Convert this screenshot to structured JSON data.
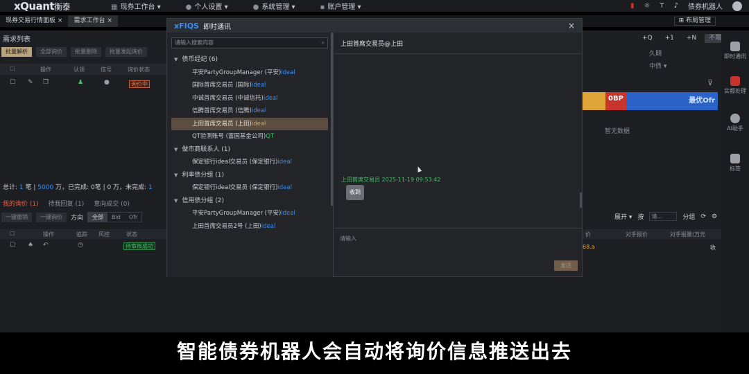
{
  "app": {
    "logo_main": "xQuant",
    "logo_sub": "衡泰",
    "nav": [
      "现券工作台",
      "个人设置",
      "系统管理",
      "账户管理"
    ],
    "user": "债券机器人"
  },
  "tabs": [
    "现券交易行情面板",
    "需求工作台"
  ],
  "layout_button": "布局管理",
  "background": {
    "section_title": "需求列表",
    "buttons": [
      "批量解析",
      "全部询价",
      "批量删除",
      "批量发起询价"
    ],
    "grid_headers": [
      "操作",
      "认领",
      "信号",
      "询价状态"
    ],
    "status_tag": "询价中",
    "stat_prefix": "总计:",
    "stat_count": "1",
    "stat_amount": "5000",
    "stat_tail": "万，已完成:",
    "stat_done": "0",
    "stat_tail2": "笔 | 0 万，未完成:",
    "stat_open": "1",
    "sub_tabs": [
      "我的询价 (1)",
      "待我回复 (1)",
      "意向成交 (0)"
    ],
    "sub_buttons": [
      "一键撤销",
      "一键询价"
    ],
    "direction_label": "方向",
    "direction_options": [
      "全部",
      "Bid",
      "Ofr"
    ],
    "grid2_headers": [
      "操作",
      "追踪",
      "风控",
      "状态"
    ],
    "status_tag2": "待审核成功",
    "right_top": [
      "+Q",
      "+1",
      "+N",
      "不限"
    ],
    "right_labels": [
      "久期",
      "中债"
    ],
    "bar_label": "0BP",
    "bar_label2": "最优Ofr",
    "no_data": "暂无数据",
    "right_row2": [
      "展开",
      "按",
      "分组"
    ],
    "right_select": "请...",
    "right_headers": [
      "价",
      "对手报价",
      "对手报量(万元"
    ],
    "right_value": "68.a",
    "right_tail": "收"
  },
  "dock": [
    "即时通讯",
    "实都处理",
    "AI助手",
    "标签"
  ],
  "modal": {
    "brand": "xFIQS",
    "title": "即时通讯",
    "close": "×",
    "search_placeholder": "请输入搜索内容",
    "groups": [
      {
        "name": "债币经纪 (6)",
        "items": [
          {
            "name": "平安PartyGroupManager (平安)",
            "prov": "ideal"
          },
          {
            "name": "国际首席交易员 (国际)",
            "prov": "ideal"
          },
          {
            "name": "中诚首席交易员 (中诚信托)",
            "prov": "ideal"
          },
          {
            "name": "信腾首席交易员 (信腾)",
            "prov": "ideal"
          },
          {
            "name": "上田首席交易员 (上田)",
            "prov": "ideal",
            "selected": true
          },
          {
            "name": "QT验测账号 (富国基金公司)",
            "prov": "QT",
            "qt": true
          }
        ]
      },
      {
        "name": "做市商联系人 (1)",
        "items": [
          {
            "name": "保定银行ideal交易员 (保定银行)",
            "prov": "ideal"
          }
        ]
      },
      {
        "name": "利率债分组 (1)",
        "items": [
          {
            "name": "保定银行ideal交易员 (保定银行)",
            "prov": "ideal"
          }
        ]
      },
      {
        "name": "信用债分组 (2)",
        "items": [
          {
            "name": "平安PartyGroupManager (平安)",
            "prov": "ideal"
          },
          {
            "name": "上田首席交易员2号 (上田)",
            "prov": "ideal"
          }
        ]
      }
    ],
    "chat_title": "上田首席交易员@上田",
    "message_meta": "上田首席交易员 2025-11-19 09:53:42",
    "message_text": "收到",
    "input_placeholder": "请输入",
    "send_button": "发送"
  },
  "caption": "智能债券机器人会自动将询价信息推送出去"
}
